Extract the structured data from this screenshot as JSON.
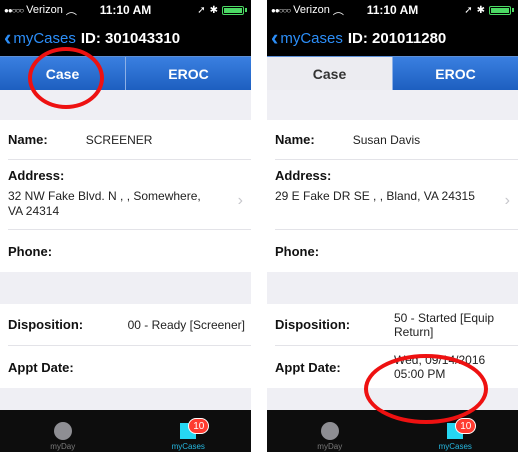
{
  "screens": [
    {
      "status": {
        "carrier": "Verizon",
        "time": "11:10 AM"
      },
      "nav": {
        "back_label": "myCases",
        "title": "ID: 301043310"
      },
      "segments": [
        "Case",
        "EROC"
      ],
      "case": {
        "name_label": "Name:",
        "name_value": "SCREENER",
        "address_label": "Address:",
        "address_value": "32 NW Fake Blvd. N ,  , Somewhere, VA 24314",
        "phone_label": "Phone:",
        "phone_value": "",
        "disposition_label": "Disposition:",
        "disposition_value": "00 - Ready [Screener]",
        "appt_label": "Appt Date:",
        "appt_value": ""
      },
      "tabs": [
        {
          "label": "myDay",
          "icon": "circle-icon"
        },
        {
          "label": "myCases",
          "icon": "square-icon",
          "badge": "10"
        }
      ]
    },
    {
      "status": {
        "carrier": "Verizon",
        "time": "11:10 AM"
      },
      "nav": {
        "back_label": "myCases",
        "title": "ID: 201011280"
      },
      "segments": [
        "Case",
        "EROC"
      ],
      "case": {
        "name_label": "Name:",
        "name_value": "Susan Davis",
        "address_label": "Address:",
        "address_value": "29 E Fake DR SE ,  , Bland, VA 24315",
        "phone_label": "Phone:",
        "phone_value": "",
        "disposition_label": "Disposition:",
        "disposition_value": "50 - Started [Equip Return]",
        "appt_label": "Appt Date:",
        "appt_value": "Wed, 09/14/2016 05:00 PM"
      },
      "tabs": [
        {
          "label": "myDay",
          "icon": "circle-icon"
        },
        {
          "label": "myCases",
          "icon": "square-icon",
          "badge": "10"
        }
      ]
    }
  ],
  "colors": {
    "accent": "#1f65c6",
    "back_link": "#2c8ef8",
    "annotation": "#ee1111",
    "badge": "#ff3b30",
    "tab_active": "#26d7f2"
  }
}
